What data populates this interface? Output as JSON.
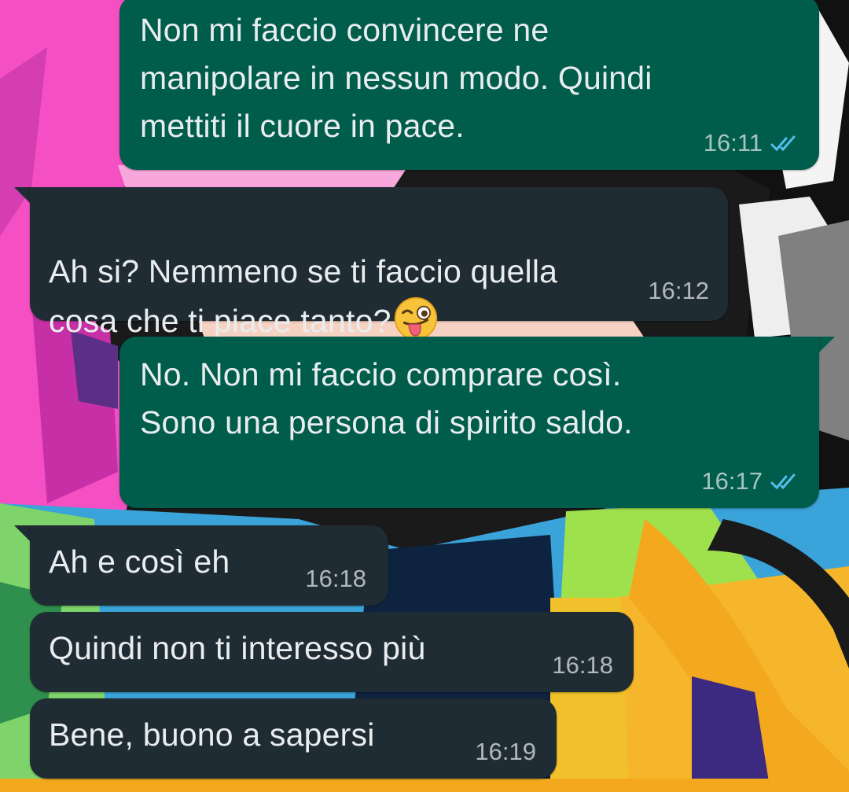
{
  "chat": {
    "messages": [
      {
        "direction": "out",
        "text": "Non mi faccio convincere ne\nmanipolare in nessun modo. Quindi\nmettiti il cuore in pace.",
        "time": "16:11",
        "status": "read-double-tick-icon"
      },
      {
        "direction": "in",
        "text": "Ah si? Nemmeno se ti faccio quella\ncosa che ti piace tanto?",
        "emoji": "winking-face-with-tongue",
        "time": "16:12"
      },
      {
        "direction": "out",
        "text": "No. Non mi faccio comprare così.\nSono una persona di spirito saldo.",
        "time": "16:17",
        "status": "read-double-tick-icon"
      },
      {
        "direction": "in",
        "text": "Ah e così eh",
        "time": "16:18"
      },
      {
        "direction": "in",
        "text": "Quindi non ti interesso più",
        "time": "16:18"
      },
      {
        "direction": "in",
        "text": "Bene, buono a sapersi",
        "time": "16:19"
      }
    ]
  },
  "theme": {
    "outgoing_bubble": "#005c4b",
    "incoming_bubble": "#202c33",
    "text_color": "#e9edef",
    "read_tick_color": "#53bdeb"
  }
}
